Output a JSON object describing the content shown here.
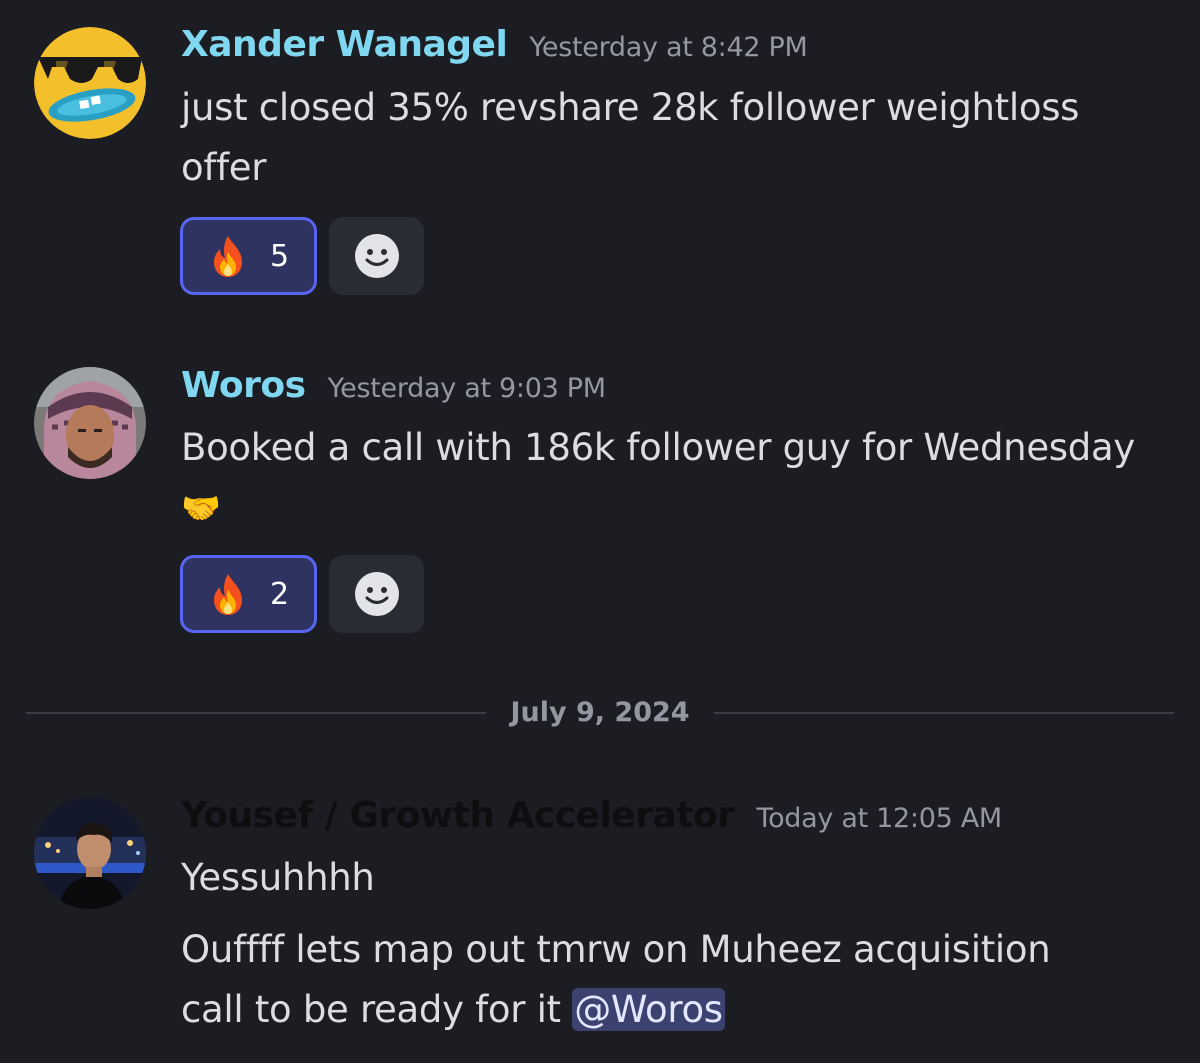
{
  "messages": [
    {
      "username": "Xander Wanagel",
      "username_color": "#7fd8f0",
      "timestamp": "Yesterday at 8:42 PM",
      "text_line1": "just closed 35% revshare 28k follower weightloss",
      "text_line2": "offer",
      "reaction_emoji_icon": "fire-icon",
      "reaction_count": "5",
      "add_reaction_icon": "smile-icon"
    },
    {
      "username": "Woros",
      "username_color": "#7fd8f0",
      "timestamp": "Yesterday at 9:03 PM",
      "text_line1": "Booked a call with 186k follower guy for Wednesday",
      "emoji": "🤝",
      "reaction_emoji_icon": "fire-icon",
      "reaction_count": "2",
      "add_reaction_icon": "smile-icon"
    },
    {
      "username": "Yousef / Growth Accelerator",
      "username_color": "#0d0e10",
      "timestamp": "Today at 12:05 AM",
      "text_line1": "Yessuhhhh",
      "text_line2": "Ouffff lets map out tmrw on Muheez acquisition",
      "text_line3_prefix": "call to be ready for it ",
      "mention": "@Woros"
    }
  ],
  "date_divider": "July 9, 2024",
  "colors": {
    "background": "#1c1d22",
    "reaction_bg": "#2e3361",
    "reaction_border": "#5865f2",
    "mention_bg": "#3c4270"
  }
}
